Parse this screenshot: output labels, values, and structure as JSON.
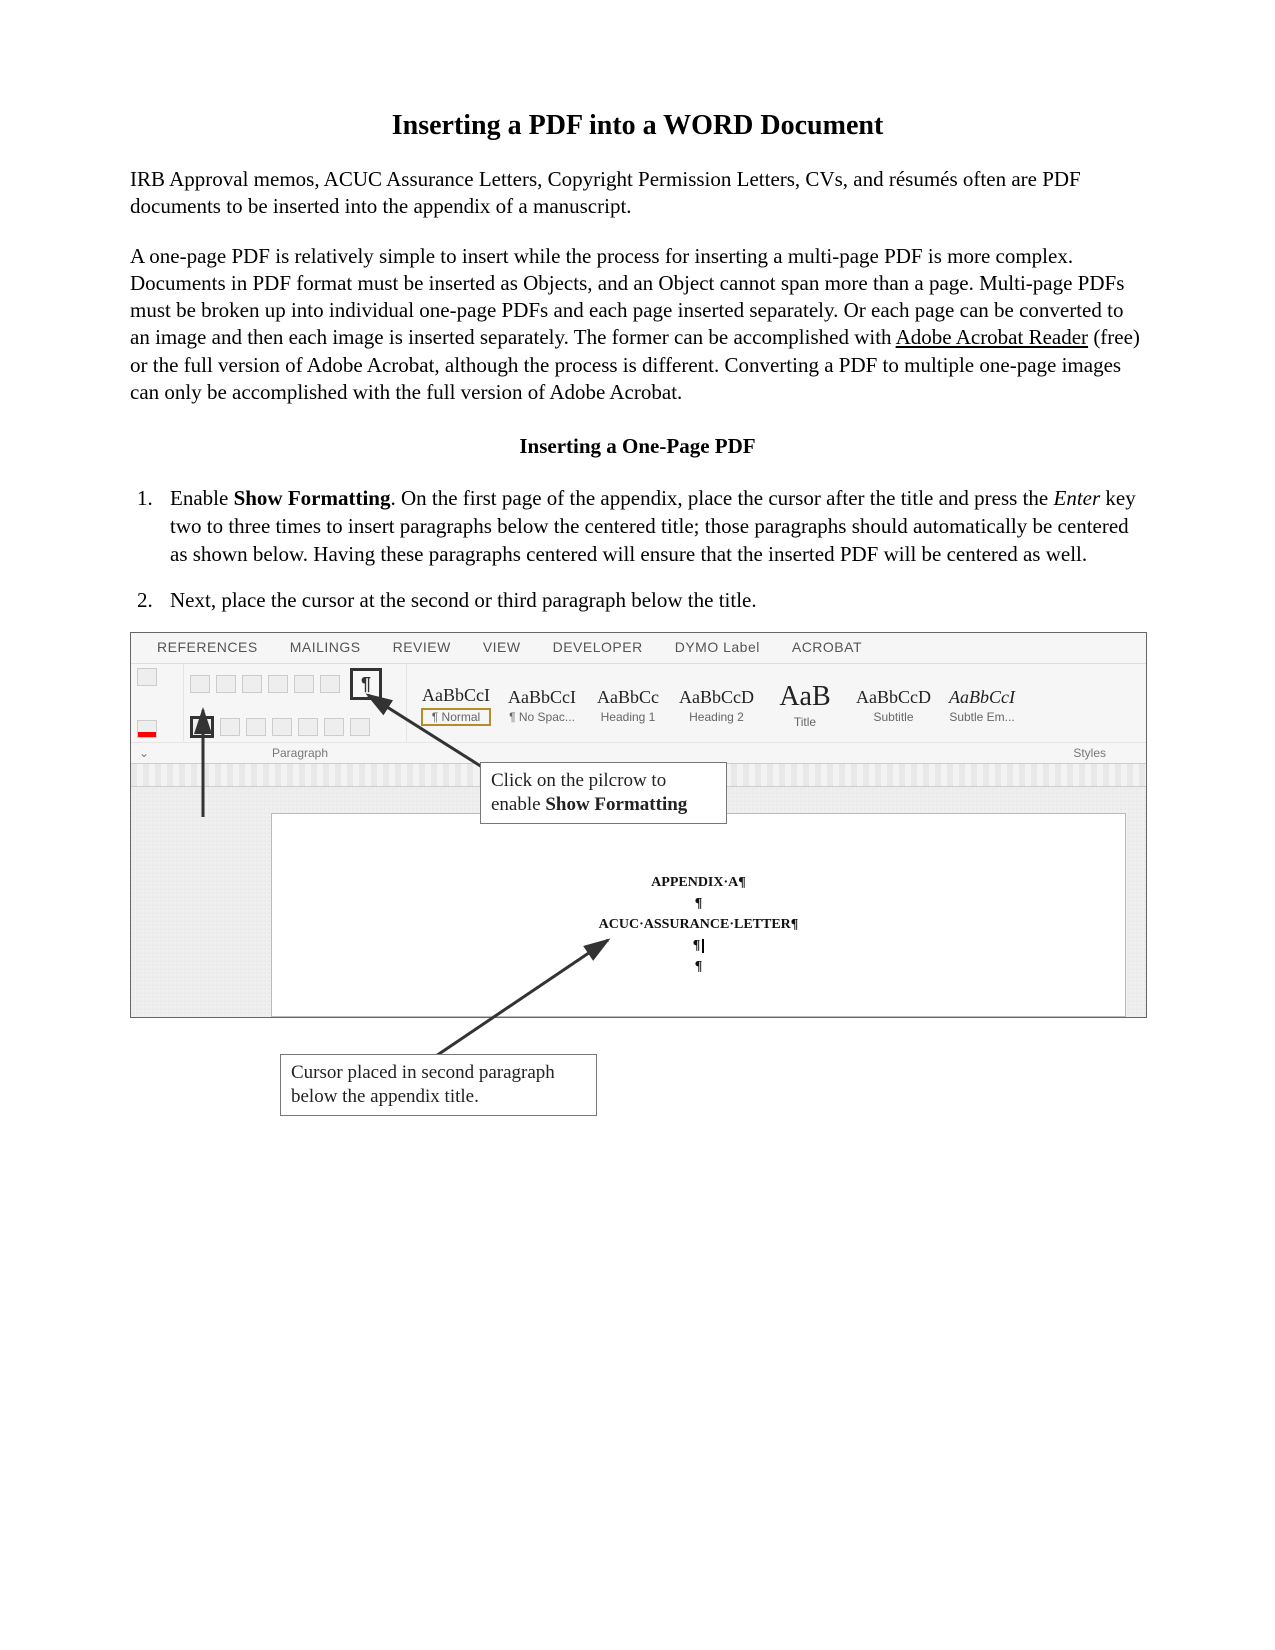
{
  "title": "Inserting a PDF into a WORD Document",
  "intro1": "IRB Approval memos, ACUC Assurance Letters, Copyright Permission Letters, CVs, and résumés often are PDF documents to be inserted into the appendix of a manuscript.",
  "intro2_a": "A one-page PDF is relatively simple to insert while the process for inserting a multi-page PDF is more complex. Documents in PDF format must be inserted as Objects, and an Object cannot span more than a page. Multi-page PDFs must be broken up into individual one-page PDFs and each page inserted separately. Or each page can be converted to an image and then each image is inserted separately. The former can be accomplished with ",
  "intro2_link": "Adobe Acrobat Reader",
  "intro2_b": " (free) or the full version of Adobe Acrobat, although the process is different. Converting a PDF to multiple one-page images can only be accomplished with the full version of Adobe Acrobat.",
  "section1": "Inserting a One-Page PDF",
  "step1_a": "Enable ",
  "step1_bold": "Show Formatting",
  "step1_b": ". On the first page of the appendix, place the cursor after the title and press the ",
  "step1_italic": "Enter",
  "step1_c": " key two to three times to insert paragraphs below the centered title; those paragraphs should automatically be centered as shown below. Having these paragraphs centered will ensure that the inserted PDF will be centered as well.",
  "step2": "Next, place the cursor at the second or third paragraph below the title.",
  "ribbon": {
    "tabs": [
      "REFERENCES",
      "MAILINGS",
      "REVIEW",
      "VIEW",
      "DEVELOPER",
      "DYMO Label",
      "ACROBAT"
    ],
    "paragraph_label": "Paragraph",
    "styles_label": "Styles",
    "styles": [
      {
        "sample": "AaBbCcI",
        "name": "¶ Normal",
        "boxed": true
      },
      {
        "sample": "AaBbCcI",
        "name": "¶ No Spac..."
      },
      {
        "sample": "AaBbCc",
        "name": "Heading 1"
      },
      {
        "sample": "AaBbCcD",
        "name": "Heading 2"
      },
      {
        "sample": "AaB",
        "name": "Title",
        "big": true
      },
      {
        "sample": "AaBbCcD",
        "name": "Subtitle"
      },
      {
        "sample": "AaBbCcI",
        "name": "Subtle Em...",
        "ital": true
      }
    ]
  },
  "doc": {
    "line1": "APPENDIX·A¶",
    "pilcrow": "¶",
    "line2": "ACUC·ASSURANCE·LETTER¶"
  },
  "callout1_a": "Click on the pilcrow to enable ",
  "callout1_b": "Show Formatting",
  "callout2": "Cursor placed in second paragraph below the appendix title."
}
